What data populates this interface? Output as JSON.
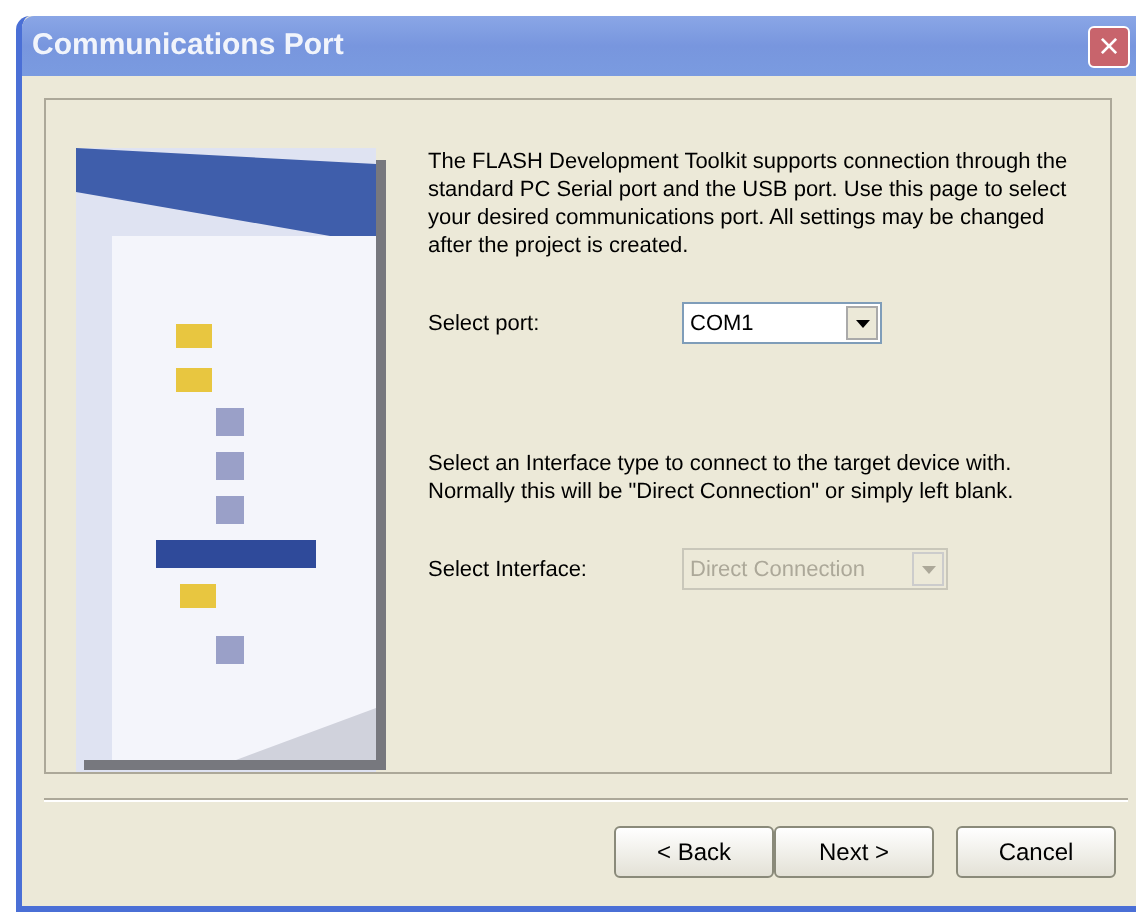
{
  "window": {
    "title": "Communications Port",
    "close": "×"
  },
  "description": "The FLASH Development Toolkit supports connection through the standard PC Serial port and the USB port. Use this page to select your desired communications port. All settings may be changed after the project is created.",
  "port": {
    "label": "Select port:",
    "value": "COM1",
    "disabled": false
  },
  "interface_hint": "Select an Interface type to connect to the target device with. Normally this will be \"Direct Connection\" or simply left blank.",
  "interface": {
    "label": "Select Interface:",
    "value": "Direct Connection",
    "disabled": true
  },
  "buttons": [
    {
      "label": "< Back"
    },
    {
      "label": "Next >"
    },
    {
      "label": "Cancel"
    }
  ]
}
